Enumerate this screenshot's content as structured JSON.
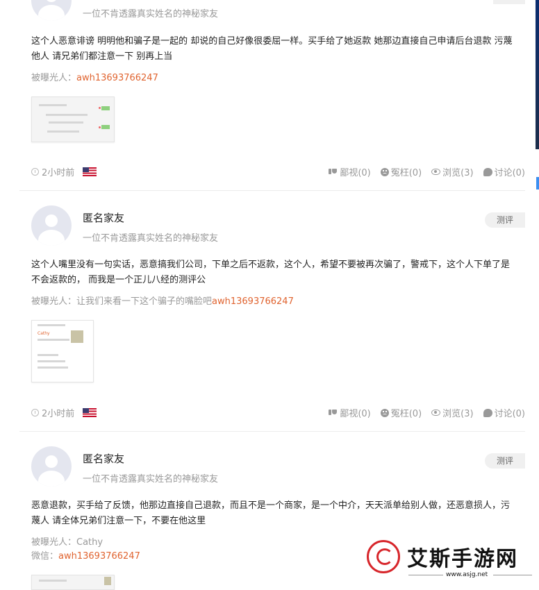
{
  "posts": [
    {
      "author": "",
      "subtitle": "一位不肯透露真实姓名的神秘家友",
      "content": "这个人恶意诽谤 明明他和骗子是一起的 却说的自己好像很委屈一样。买手给了她返款 她那边直接自己申请后台退款 污蔑他人 请兄弟们都注意一下 别再上当",
      "exposed": [
        {
          "label": "被曝光人：",
          "link": "awh13693766247"
        }
      ],
      "time": "2小时前",
      "stats": {
        "report": "鄙视(0)",
        "wronged": "冤枉(0)",
        "views": "浏览(3)",
        "comments": "讨论(0)"
      }
    },
    {
      "author": "匿名家友",
      "subtitle": "一位不肯透露真实姓名的神秘家友",
      "tag": "测评",
      "content": "这个人嘴里没有一句实话，恶意搞我们公司，下单之后不返款，这个人，希望不要被再次骗了，警戒下，这个人下单了是不会返款的， 而我是一个正儿八经的测评公",
      "exposed": [
        {
          "label": "被曝光人：让我们来看一下这个骗子的嘴脸吧",
          "link": "awh13693766247"
        }
      ],
      "thumb_name": "Cathy",
      "time": "2小时前",
      "stats": {
        "report": "鄙视(0)",
        "wronged": "冤枉(0)",
        "views": "浏览(3)",
        "comments": "讨论(0)"
      }
    },
    {
      "author": "匿名家友",
      "subtitle": "一位不肯透露真实姓名的神秘家友",
      "tag": "测评",
      "content": "恶意退款，买手给了反馈，他那边直接自己退款，而且不是一个商家，是一个中介，天天派单给别人做，还恶意损人，污蔑人 请全体兄弟们注意一下，不要在他这里",
      "exposed": [
        {
          "label": "被曝光人：Cathy",
          "link": ""
        },
        {
          "label": "微信：",
          "link": "awh13693766247"
        }
      ]
    }
  ],
  "watermark": {
    "title": "艾斯手游网",
    "url": "www.asjg.net"
  },
  "colors": {
    "link": "#e0632f",
    "tag_bg": "#f0f0f0"
  }
}
